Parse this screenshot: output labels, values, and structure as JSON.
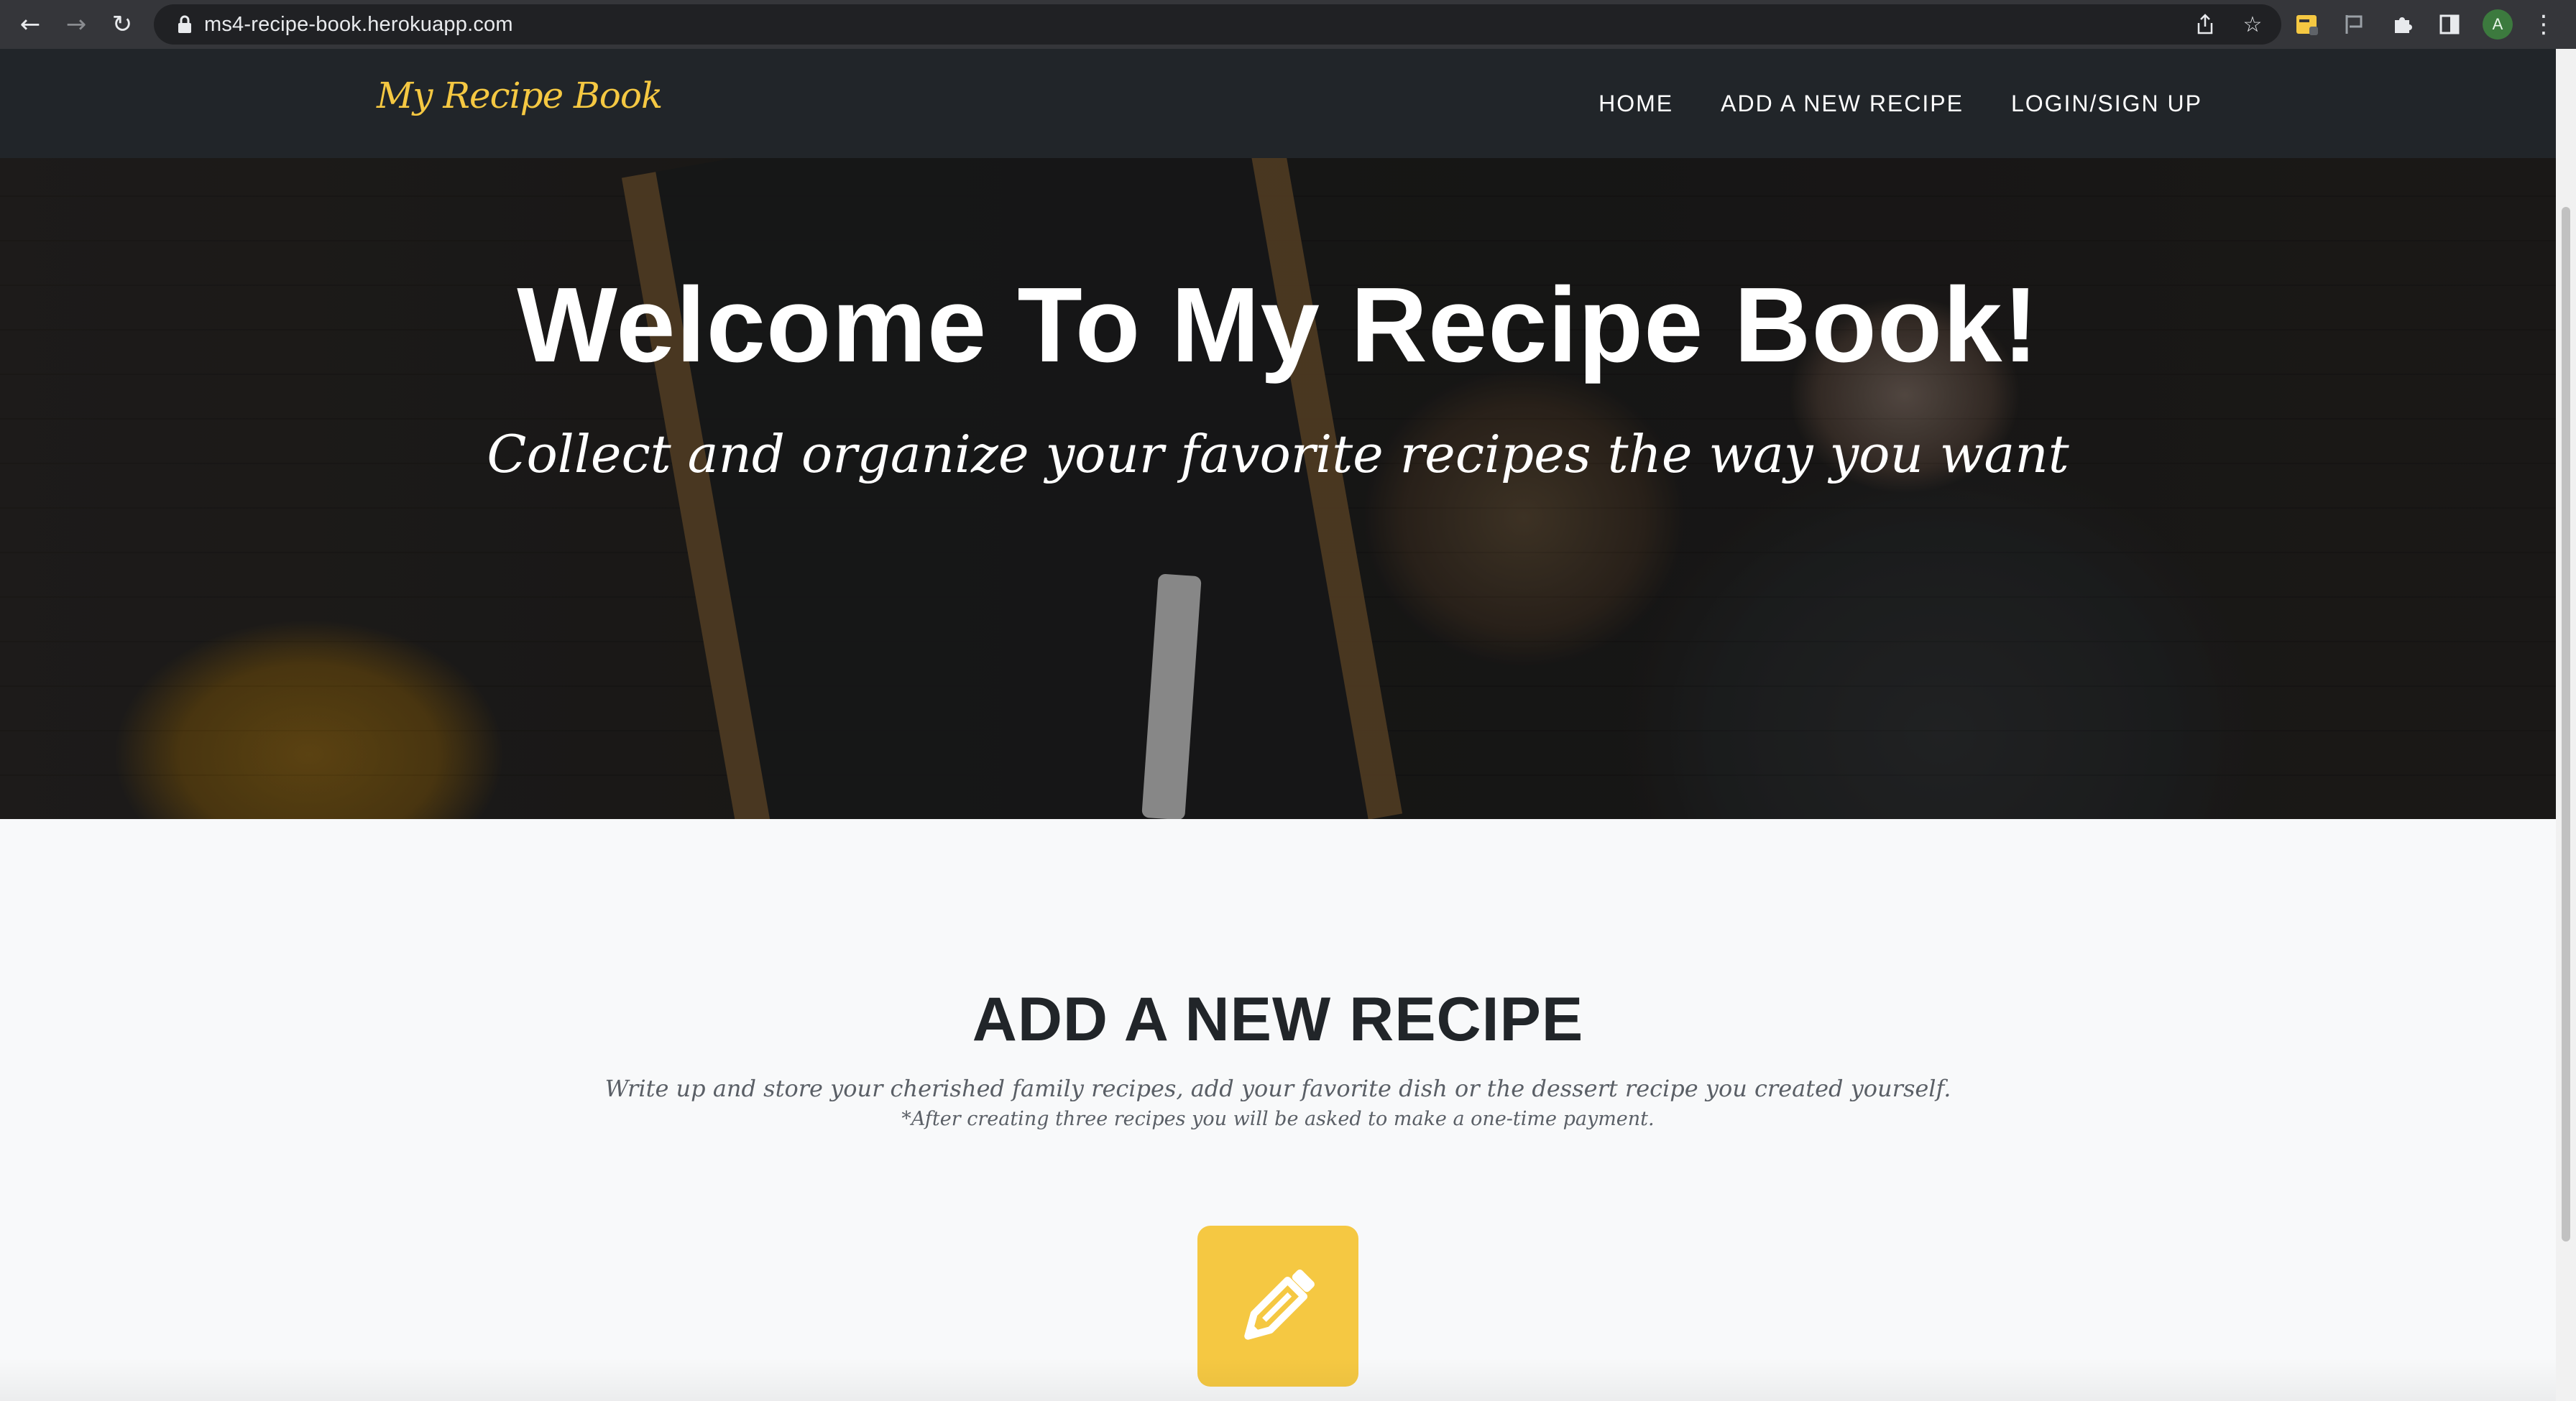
{
  "browser": {
    "url": "ms4-recipe-book.herokuapp.com",
    "avatar_letter": "A",
    "icons": [
      "back-arrow-icon",
      "forward-arrow-icon",
      "reload-icon",
      "lock-icon",
      "share-icon",
      "bookmark-star-icon",
      "extension-icon",
      "puzzle-icon",
      "side-panel-icon",
      "kebab-menu-icon"
    ]
  },
  "nav": {
    "brand": "My Recipe Book",
    "links": [
      "HOME",
      "ADD A NEW RECIPE",
      "LOGIN/SIGN UP"
    ]
  },
  "hero": {
    "title": "Welcome To My Recipe Book!",
    "subtitle": "Collect and organize your favorite recipes the way you want"
  },
  "add_section": {
    "title": "ADD A NEW RECIPE",
    "description": "Write up and store your cherished family recipes, add your favorite dish or the dessert recipe you created yourself.",
    "note": "*After creating three recipes you will be asked to make a one-time payment.",
    "button_icon": "pencil-icon"
  },
  "colors": {
    "accent": "#f5c842",
    "navbar": "#212529",
    "page_bg": "#f8f9fa",
    "heading": "#212529"
  }
}
